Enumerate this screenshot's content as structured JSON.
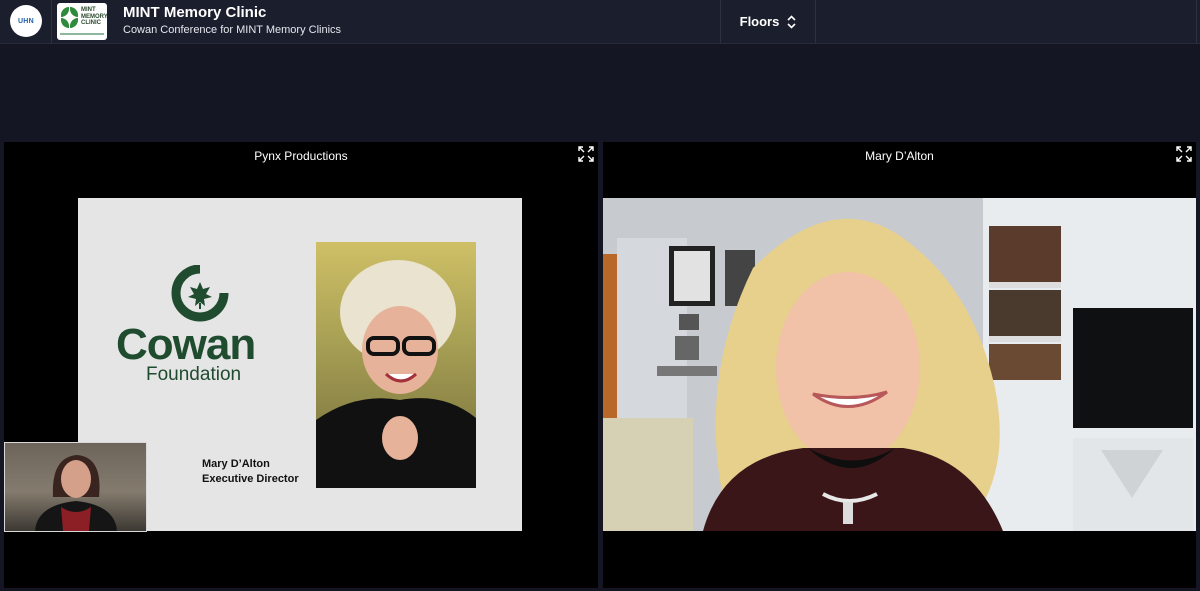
{
  "header": {
    "org_logo_text": "UHN",
    "clinic_logo_text": "MINT MEMORY CLINIC",
    "title": "MINT Memory Clinic",
    "subtitle": "Cowan Conference for MINT Memory Clinics",
    "floors_label": "Floors"
  },
  "panels": [
    {
      "title": "Pynx Productions",
      "slide": {
        "brand_name": "Cowan",
        "brand_sub": "Foundation",
        "speaker_name": "Mary D’Alton",
        "speaker_role": "Executive Director"
      }
    },
    {
      "title": "Mary D’Alton"
    }
  ],
  "colors": {
    "background": "#141623",
    "header": "#1b1e2d",
    "cowan_green": "#1f4b2e"
  },
  "icons": [
    "expand-icon",
    "chevron-updown-icon"
  ]
}
